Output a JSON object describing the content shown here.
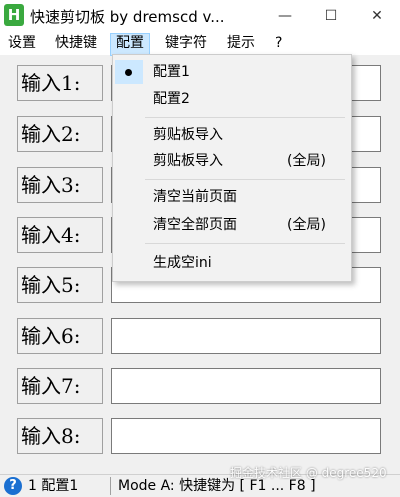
{
  "window": {
    "title": "快速剪切板 by dremscd v...",
    "icon_letter": "H",
    "controls": {
      "minimize": "—",
      "maximize": "☐",
      "close": "✕"
    }
  },
  "menubar": {
    "items": [
      {
        "label": "设置"
      },
      {
        "label": "快捷键"
      },
      {
        "label": "配置",
        "active": true
      },
      {
        "label": "键字符"
      },
      {
        "label": "提示"
      },
      {
        "label": "?"
      }
    ]
  },
  "config_menu": {
    "items": [
      {
        "label": "配置1",
        "checked": true
      },
      {
        "label": "配置2"
      },
      {
        "label": "剪贴板导入"
      },
      {
        "label": "剪贴板导入",
        "shortcut": "(全局)"
      },
      {
        "label": "清空当前页面"
      },
      {
        "label": "清空全部页面",
        "shortcut": "(全局)"
      },
      {
        "label": "生成空ini"
      }
    ]
  },
  "inputs": [
    {
      "label": "输入1:",
      "value": ""
    },
    {
      "label": "输入2:",
      "value": ""
    },
    {
      "label": "输入3:",
      "value": ""
    },
    {
      "label": "输入4:",
      "value": ""
    },
    {
      "label": "输入5:",
      "value": ""
    },
    {
      "label": "输入6:",
      "value": ""
    },
    {
      "label": "输入7:",
      "value": ""
    },
    {
      "label": "输入8:",
      "value": ""
    }
  ],
  "statusbar": {
    "config": "1 配置1",
    "mode": "Mode A: 快捷键为 [ F1 ... F8 ]"
  },
  "watermark": "掘金技术社区 @ degree520"
}
